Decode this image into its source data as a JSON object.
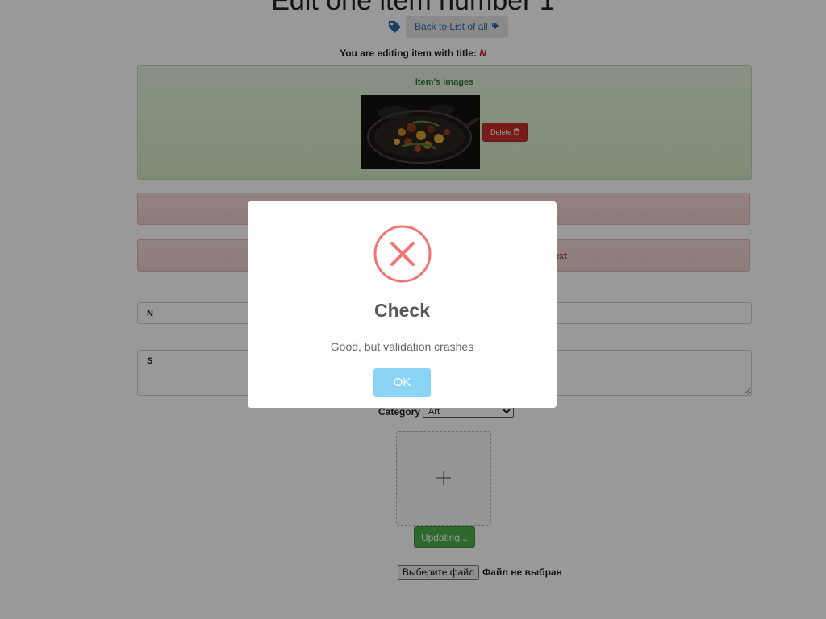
{
  "page": {
    "title": "Edit one item number 1",
    "back_button_label": "Back to List of all",
    "editing_prefix": "You are editing item with title:",
    "editing_title": "N"
  },
  "images_panel": {
    "title": "Item's images",
    "delete_label": "Delete"
  },
  "errors": [
    {
      "text": ""
    },
    {
      "text": "ext"
    }
  ],
  "form": {
    "name_value": "N",
    "description_value": "S",
    "category_label": "Category",
    "category_selected": "Art",
    "update_label": "Updating...",
    "file_button_label": "Выберите файл",
    "file_status": "Файл не выбран"
  },
  "modal": {
    "title": "Check",
    "text": "Good, but validation crashes",
    "ok_label": "OK",
    "icon": "error-x-icon",
    "icon_color": "#f27474"
  },
  "colors": {
    "success_panel": "#dff0d8",
    "error_panel": "#f2dede",
    "delete_button": "#c9302c",
    "update_button": "#4cae4c",
    "ok_button": "#8cd4f5"
  }
}
